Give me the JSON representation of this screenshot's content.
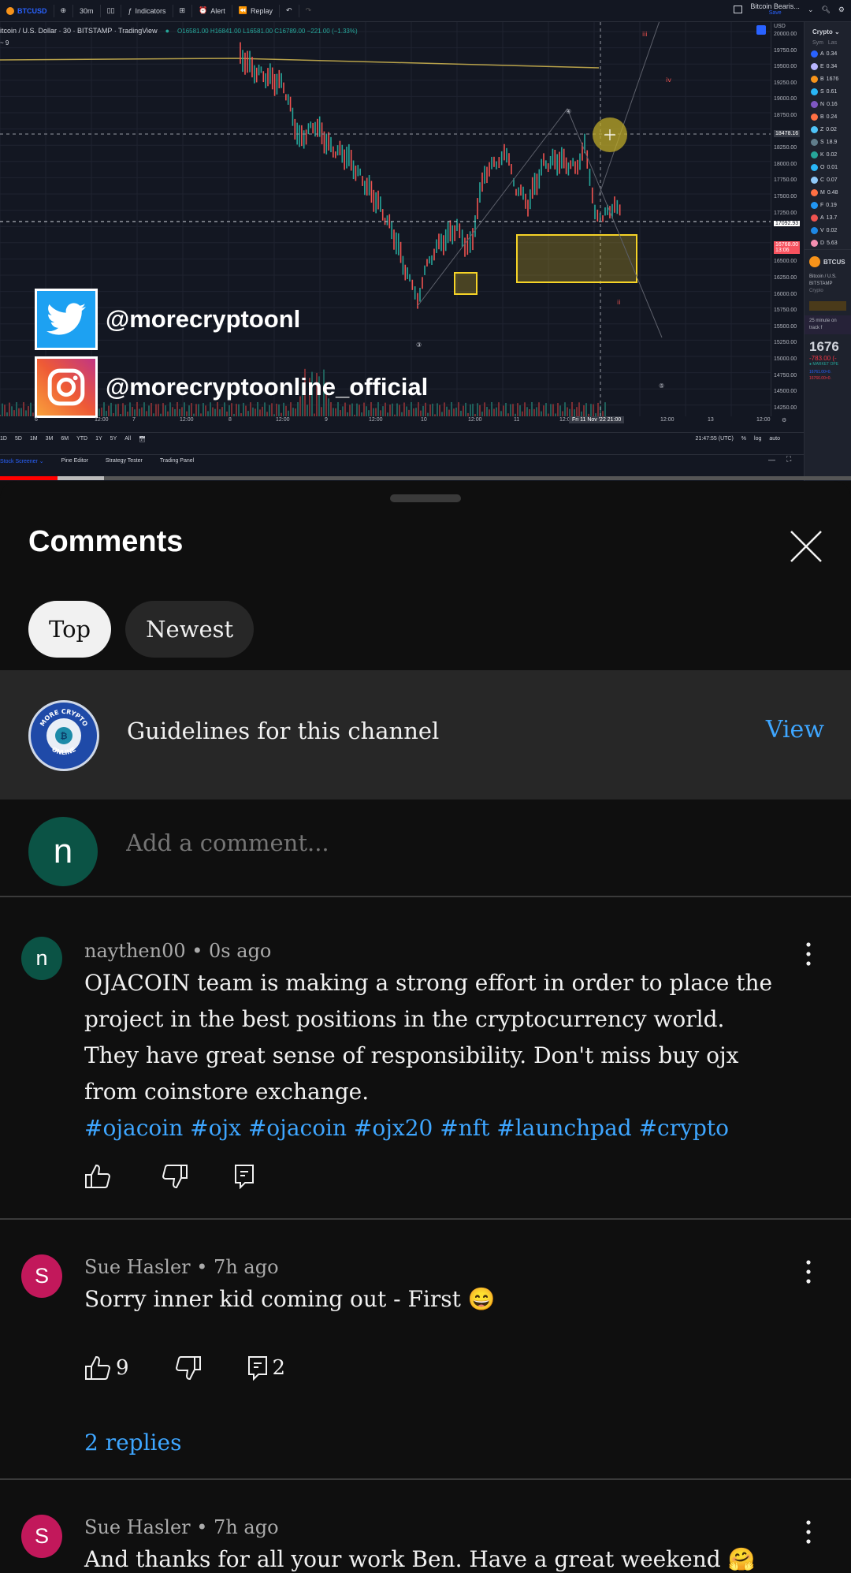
{
  "video": {
    "toolbar": {
      "symbol": "BTCUSD",
      "interval": "30m",
      "indicators_label": "Indicators",
      "alert_label": "Alert",
      "replay_label": "Replay",
      "layout_name": "Bitcoin Bearis...",
      "layout_save": "Save"
    },
    "legend": {
      "title": "itcoin / U.S. Dollar · 30 · BITSTAMP · TradingView",
      "ohlc": "O16581.00 H16841.00 L16581.00 C16789.00 −221.00 (−1.33%)",
      "indicator": "~ 9"
    },
    "price_axis": {
      "currency": "USD",
      "labels": [
        "20000.00",
        "19750.00",
        "19500.00",
        "19250.00",
        "19000.00",
        "18750.00",
        "18478.16",
        "18250.00",
        "18000.00",
        "17750.00",
        "17500.00",
        "17250.00",
        "17092.93",
        "16768.00",
        "16500.00",
        "16250.00",
        "16000.00",
        "15750.00",
        "15500.00",
        "15250.00",
        "15000.00",
        "14750.00",
        "14500.00",
        "14250.00"
      ],
      "crosshair_price": "18478.16",
      "line_price": "17092.93",
      "last_price": "16768.00",
      "last_price_countdown": "13:06"
    },
    "time_axis": {
      "labels": [
        "6",
        "12:00",
        "7",
        "12:00",
        "8",
        "12:00",
        "9",
        "12:00",
        "10",
        "12:00",
        "11",
        "12:0",
        "12:00",
        "13",
        "12:00"
      ],
      "cursor_time": "Fri 11 Nov '22  21:00"
    },
    "range_bar": {
      "ranges": [
        "1D",
        "5D",
        "1M",
        "3M",
        "6M",
        "YTD",
        "1Y",
        "5Y",
        "All"
      ],
      "clock": "21:47:55 (UTC)",
      "percent": "%",
      "log": "log",
      "auto": "auto"
    },
    "bottom_tabs": [
      "Stock Screener",
      "Pine Editor",
      "Strategy Tester",
      "Trading Panel"
    ],
    "watchlist": {
      "title": "Crypto",
      "col_symbol": "Sym",
      "col_last": "Las",
      "rows": [
        {
          "sym": "A",
          "last": "0.34",
          "color": "#2962ff"
        },
        {
          "sym": "E",
          "last": "0.34",
          "color": "#b8b5ff"
        },
        {
          "sym": "B",
          "last": "1676",
          "color": "#f7931a"
        },
        {
          "sym": "S",
          "last": "0.61",
          "color": "#29b6f6"
        },
        {
          "sym": "N",
          "last": "0.16",
          "color": "#7e57c2"
        },
        {
          "sym": "B",
          "last": "0.24",
          "color": "#ff7043"
        },
        {
          "sym": "Z",
          "last": "0.02",
          "color": "#4fc3f7"
        },
        {
          "sym": "S",
          "last": "18.9",
          "color": "#607d8b"
        },
        {
          "sym": "K",
          "last": "0.02",
          "color": "#26a69a"
        },
        {
          "sym": "O",
          "last": "0.01",
          "color": "#29b6f6"
        },
        {
          "sym": "C",
          "last": "0.07",
          "color": "#90caf9"
        },
        {
          "sym": "M",
          "last": "0.48",
          "color": "#ff7043"
        },
        {
          "sym": "F",
          "last": "0.19",
          "color": "#2196f3"
        },
        {
          "sym": "A",
          "last": "13.7",
          "color": "#ef5350"
        },
        {
          "sym": "V",
          "last": "0.02",
          "color": "#1e88e5"
        },
        {
          "sym": "D",
          "last": "5.63",
          "color": "#f48fb1"
        }
      ],
      "detail_symbol": "BTCUS",
      "detail_desc_1": "Bitcoin / U.S.",
      "detail_desc_2": "BITSTAMP",
      "detail_desc_3": "Crypto",
      "news": "25 minute on track f",
      "big_price": "1676",
      "change": "-783.00 (-",
      "market_status": "● MARKET OPE",
      "bid": "16761.00×0.",
      "ask": "16766.00×0."
    },
    "overlay": {
      "twitter_handle": "@morecryptoonl",
      "instagram_handle": "@morecryptoonline_official"
    },
    "progress": {
      "played_fraction": 0.068,
      "buffered_fraction": 0.122
    }
  },
  "comments_panel": {
    "title": "Comments",
    "sort_chips": [
      {
        "label": "Top",
        "active": true
      },
      {
        "label": "Newest",
        "active": false
      }
    ],
    "guidelines": {
      "logo_text_top": "MORE CRYPTO",
      "logo_text_bottom": "ONLINE",
      "text": "Guidelines for this channel",
      "view_label": "View"
    },
    "add_comment": {
      "avatar_letter": "n",
      "placeholder": "Add a comment..."
    },
    "comments": [
      {
        "avatar_letter": "n",
        "avatar_color": "#0b5345",
        "meta": "naythen00 • 0s ago",
        "body": "OJACOIN team is making a strong effort in order to place the project in the best positions in the cryptocurrency world. They have great sense of responsibility. Don't miss buy ojx from coinstore exchange.",
        "tags": "#ojacoin #ojx #ojacoin #ojx20 #nft #launchpad #crypto",
        "likes": "",
        "replies_count": ""
      },
      {
        "avatar_letter": "S",
        "avatar_color": "#c2185b",
        "meta": "Sue Hasler • 7h ago",
        "body": "Sorry inner kid coming out - First 😄",
        "likes": "9",
        "replies_count": "2",
        "replies_link": "2 replies"
      },
      {
        "avatar_letter": "S",
        "avatar_color": "#c2185b",
        "meta": "Sue Hasler • 7h ago",
        "body": "And thanks for all your work Ben. Have a great weekend 🤗"
      }
    ]
  }
}
